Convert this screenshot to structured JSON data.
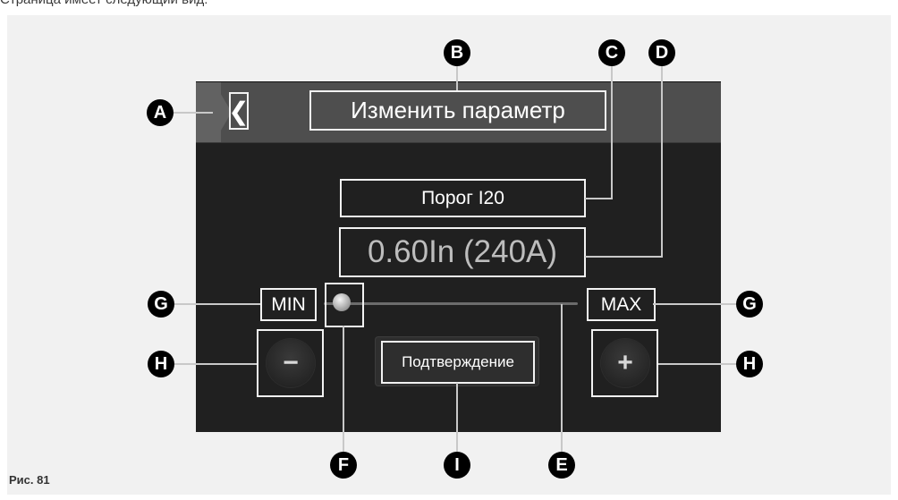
{
  "intro_text": "Страница имеет следующий вид:",
  "header": {
    "back_glyph": "❮",
    "title": "Изменить параметр"
  },
  "parameter": {
    "name": "Порог I20",
    "value": "0.60In (240A)"
  },
  "slider": {
    "min_label": "MIN",
    "max_label": "MAX",
    "position_fraction": 0.0
  },
  "buttons": {
    "minus_glyph": "−",
    "plus_glyph": "+",
    "confirm_label": "Подтверждение"
  },
  "callouts": {
    "A": "A",
    "B": "B",
    "C": "C",
    "D": "D",
    "E": "E",
    "F": "F",
    "G": "G",
    "H": "H",
    "I": "I"
  },
  "caption": "Рис. 81",
  "icons": [
    "back-chevron-icon",
    "minus-icon",
    "plus-icon"
  ],
  "colors": {
    "screen": "#202020",
    "header": "#4e4e4e",
    "frame": "#f2f2f2",
    "callout": "#000000",
    "panel": "#f1f1f1"
  }
}
